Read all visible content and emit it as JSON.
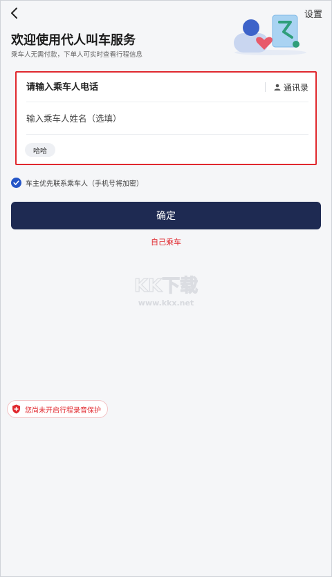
{
  "header": {
    "settings_label": "设置",
    "title": "欢迎使用代人叫车服务",
    "subtitle": "乘车人无需付款，下单人可实时查看行程信息"
  },
  "form": {
    "phone_placeholder": "请输入乘车人电话",
    "contacts_label": "通讯录",
    "name_placeholder": "输入乘车人姓名（选填）",
    "recent_chip": "哈哈"
  },
  "consent": {
    "checked": true,
    "text": "车主优先联系乘车人（手机号将加密）"
  },
  "actions": {
    "confirm_label": "确定",
    "self_ride_label": "自己乘车"
  },
  "watermark": {
    "logo_text": "KK下载",
    "url_text": "www.kkx.net"
  },
  "notice": {
    "record_text": "您尚未开启行程录音保护"
  },
  "colors": {
    "primary_dark": "#1e2a52",
    "accent_red": "#e0282e",
    "check_blue": "#2455c7",
    "background": "#f5f6f8"
  },
  "icons": {
    "back": "chevron-left-icon",
    "contacts": "person-icon",
    "check": "check-icon",
    "shield": "shield-icon"
  }
}
